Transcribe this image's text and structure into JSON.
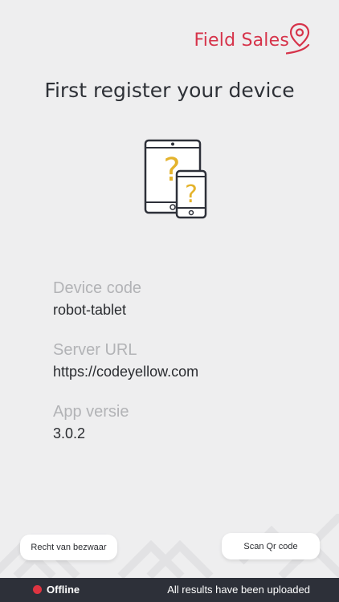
{
  "header": {
    "logo_text": "Field Sales",
    "brand_color": "#d6334a",
    "logo_icon": "location-pin-icon"
  },
  "main": {
    "title": "First register your device",
    "illustration_icon": "devices-question-icon",
    "info": [
      {
        "label": "Device code",
        "value": "robot-tablet"
      },
      {
        "label": "Server URL",
        "value": "https://codeyellow.com"
      },
      {
        "label": "App versie",
        "value": "3.0.2"
      }
    ]
  },
  "buttons": {
    "objection": "Recht van bezwaar",
    "scan_qr": "Scan Qr code"
  },
  "status_bar": {
    "status": "Offline",
    "status_color": "#de3441",
    "message": "All results have been uploaded"
  }
}
